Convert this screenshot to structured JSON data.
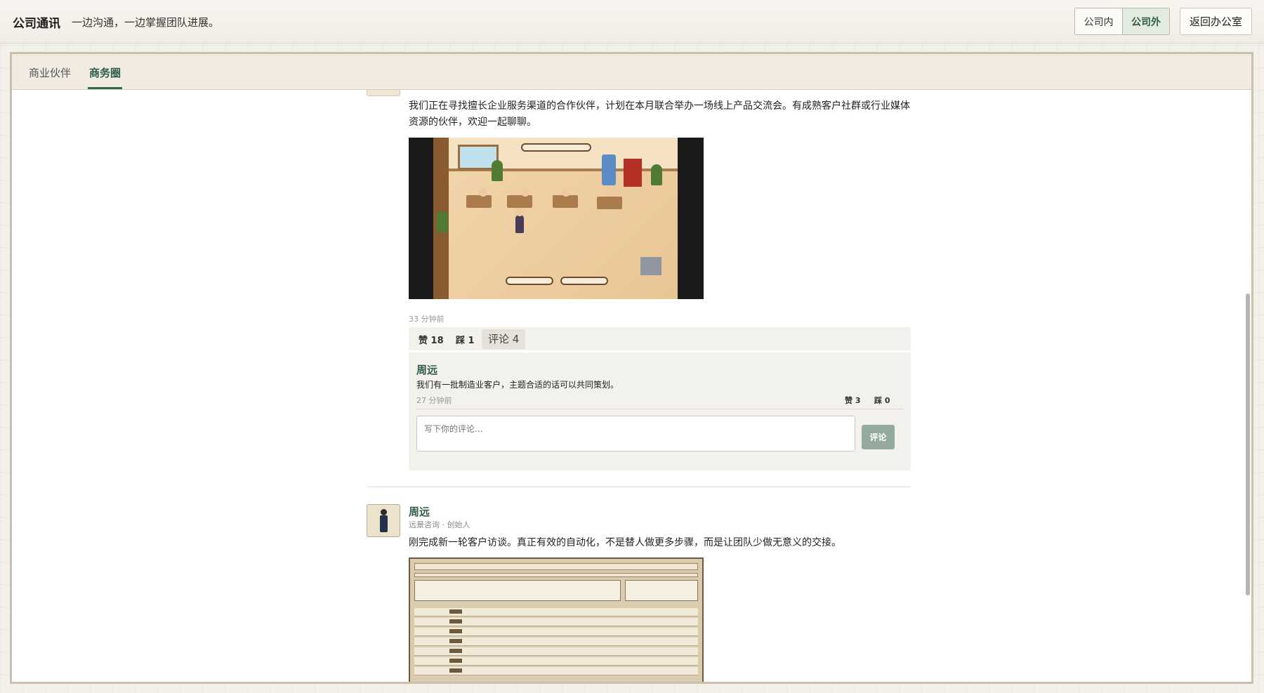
{
  "header": {
    "title": "公司通讯",
    "subtitle": "一边沟通，一边掌握团队进展。",
    "segment": [
      "公司内",
      "公司外"
    ],
    "back_label": "返回办公室"
  },
  "tabs": [
    "商业伙伴",
    "商务圈"
  ],
  "post1": {
    "text": "我们正在寻找擅长企业服务渠道的合作伙伴，计划在本月联合举办一场线上产品交流会。有成熟客户社群或行业媒体资源的伙伴，欢迎一起聊聊。",
    "time": "33 分钟前",
    "like": "赞 18",
    "dislike": "踩 1",
    "comment": "评论 4",
    "comments": [
      {
        "author": "周远",
        "text": "我们有一批制造业客户，主题合适的话可以共同策划。",
        "time": "27 分钟前",
        "like": "赞 3",
        "dislike": "踩 0"
      }
    ],
    "comment_placeholder": "写下你的评论...",
    "comment_submit": "评论"
  },
  "post2": {
    "author": "周远",
    "role": "远景咨询 · 创始人",
    "text": "刚完成新一轮客户访谈。真正有效的自动化，不是替人做更多步骤，而是让团队少做无意义的交接。"
  }
}
